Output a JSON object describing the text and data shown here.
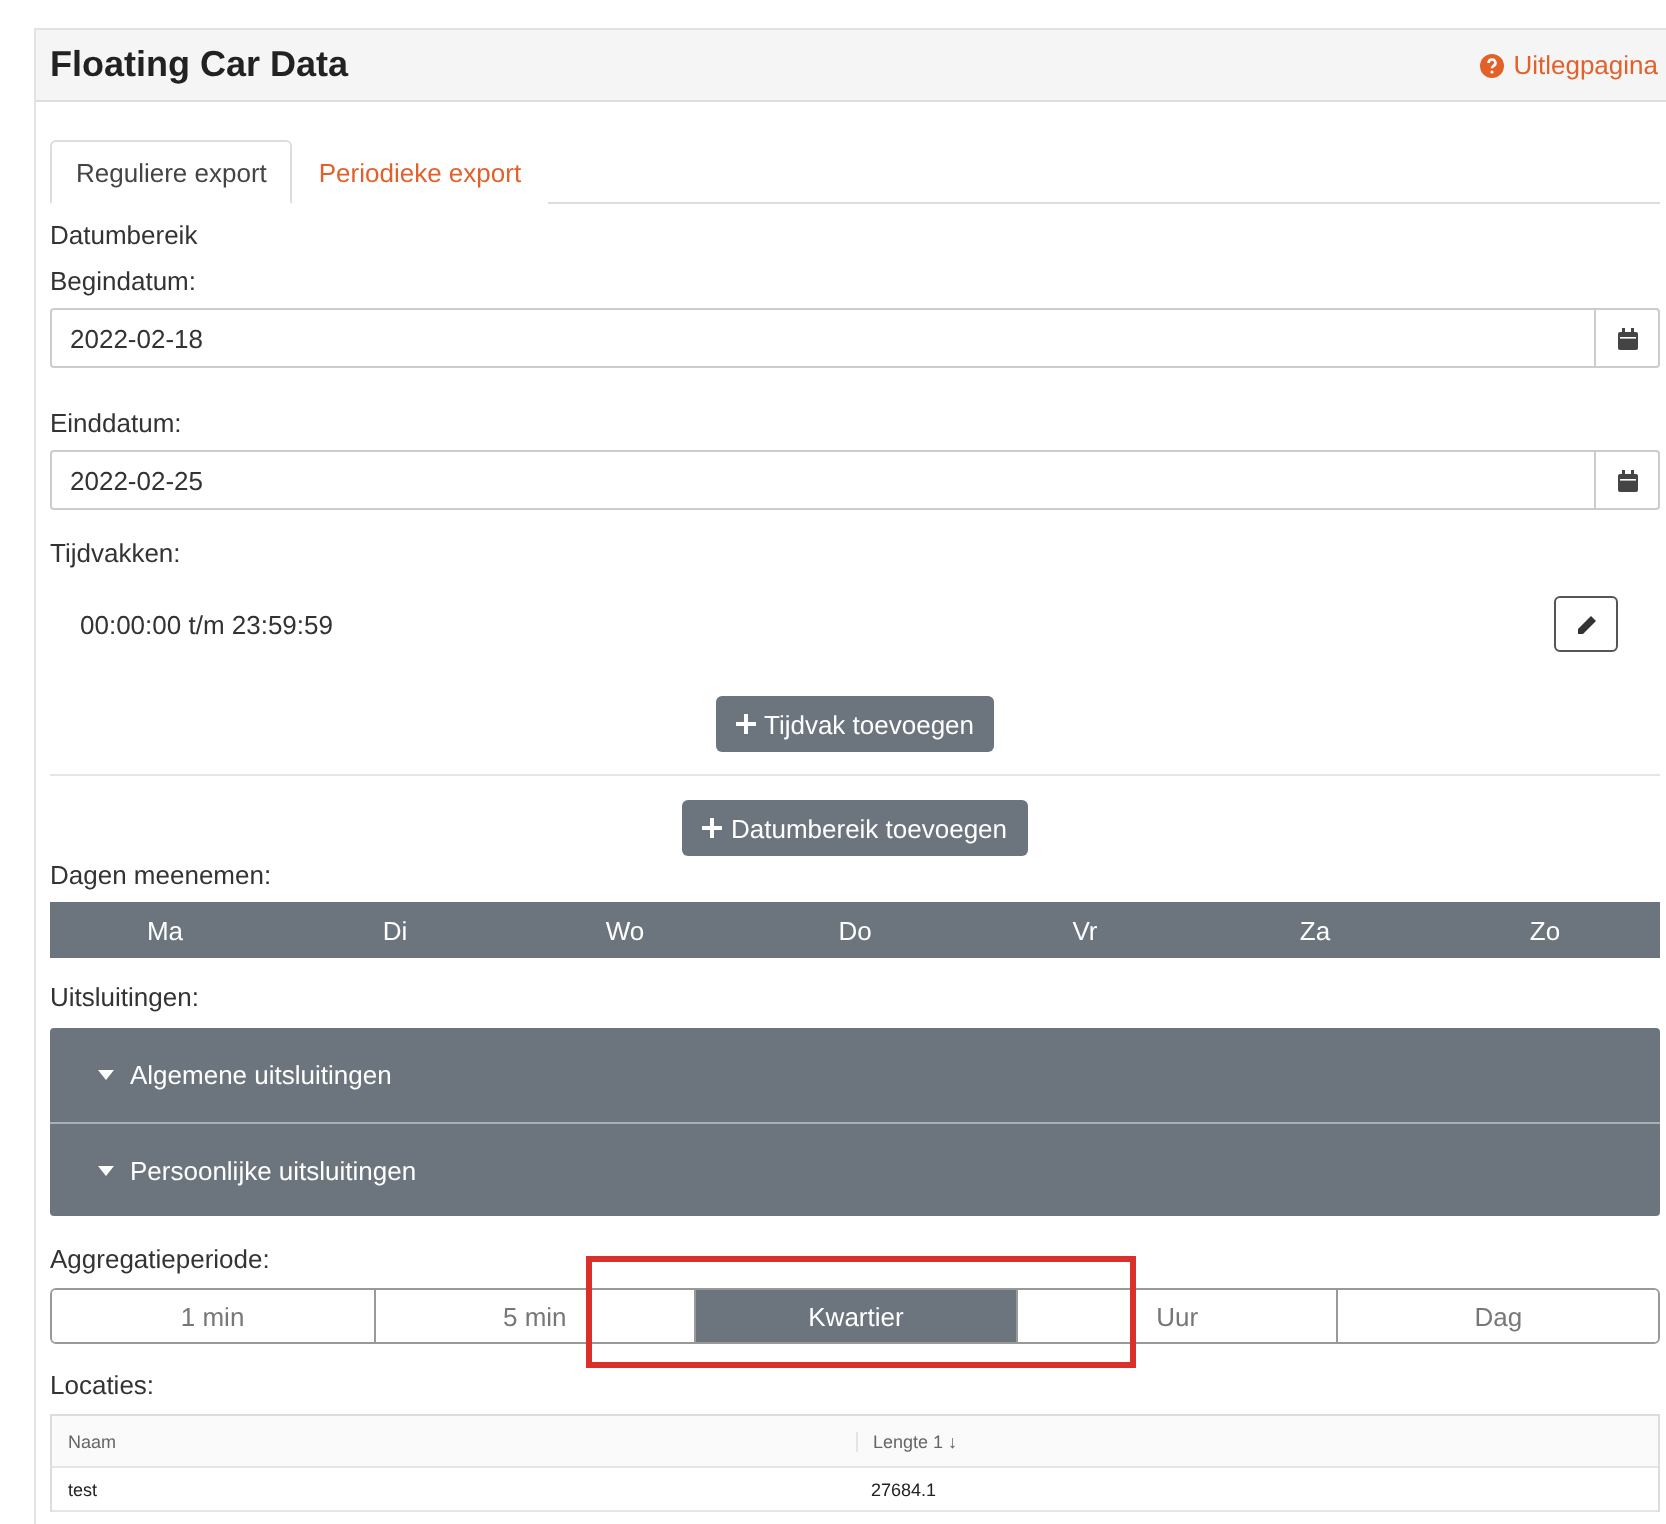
{
  "header": {
    "title": "Floating Car Data",
    "help_link": "Uitlegpagina"
  },
  "tabs": [
    {
      "label": "Reguliere export",
      "selected": true
    },
    {
      "label": "Periodieke export",
      "selected": false
    }
  ],
  "date_range": {
    "heading": "Datumbereik",
    "start": {
      "label": "Begindatum:",
      "value": "2022-02-18"
    },
    "end": {
      "label": "Einddatum:",
      "value": "2022-02-25"
    }
  },
  "time_slots": {
    "label": "Tijdvakken:",
    "items": [
      "00:00:00 t/m 23:59:59"
    ],
    "add_button": "Tijdvak toevoegen"
  },
  "add_date_range_button": "Datumbereik toevoegen",
  "days": {
    "label": "Dagen meenemen:",
    "items": [
      {
        "label": "Ma",
        "selected": true
      },
      {
        "label": "Di",
        "selected": true
      },
      {
        "label": "Wo",
        "selected": true
      },
      {
        "label": "Do",
        "selected": true
      },
      {
        "label": "Vr",
        "selected": true
      },
      {
        "label": "Za",
        "selected": true
      },
      {
        "label": "Zo",
        "selected": true
      }
    ]
  },
  "exclusions": {
    "label": "Uitsluitingen:",
    "items": [
      "Algemene uitsluitingen",
      "Persoonlijke uitsluitingen"
    ]
  },
  "aggregation": {
    "label": "Aggregatieperiode:",
    "options": [
      {
        "label": "1 min",
        "selected": false
      },
      {
        "label": "5 min",
        "selected": false
      },
      {
        "label": "Kwartier",
        "selected": true
      },
      {
        "label": "Uur",
        "selected": false
      },
      {
        "label": "Dag",
        "selected": false
      }
    ]
  },
  "locations": {
    "label": "Locaties:",
    "columns": [
      "Naam",
      "Lengte 1 ↓"
    ],
    "rows": [
      [
        "test",
        "27684.1"
      ]
    ]
  }
}
